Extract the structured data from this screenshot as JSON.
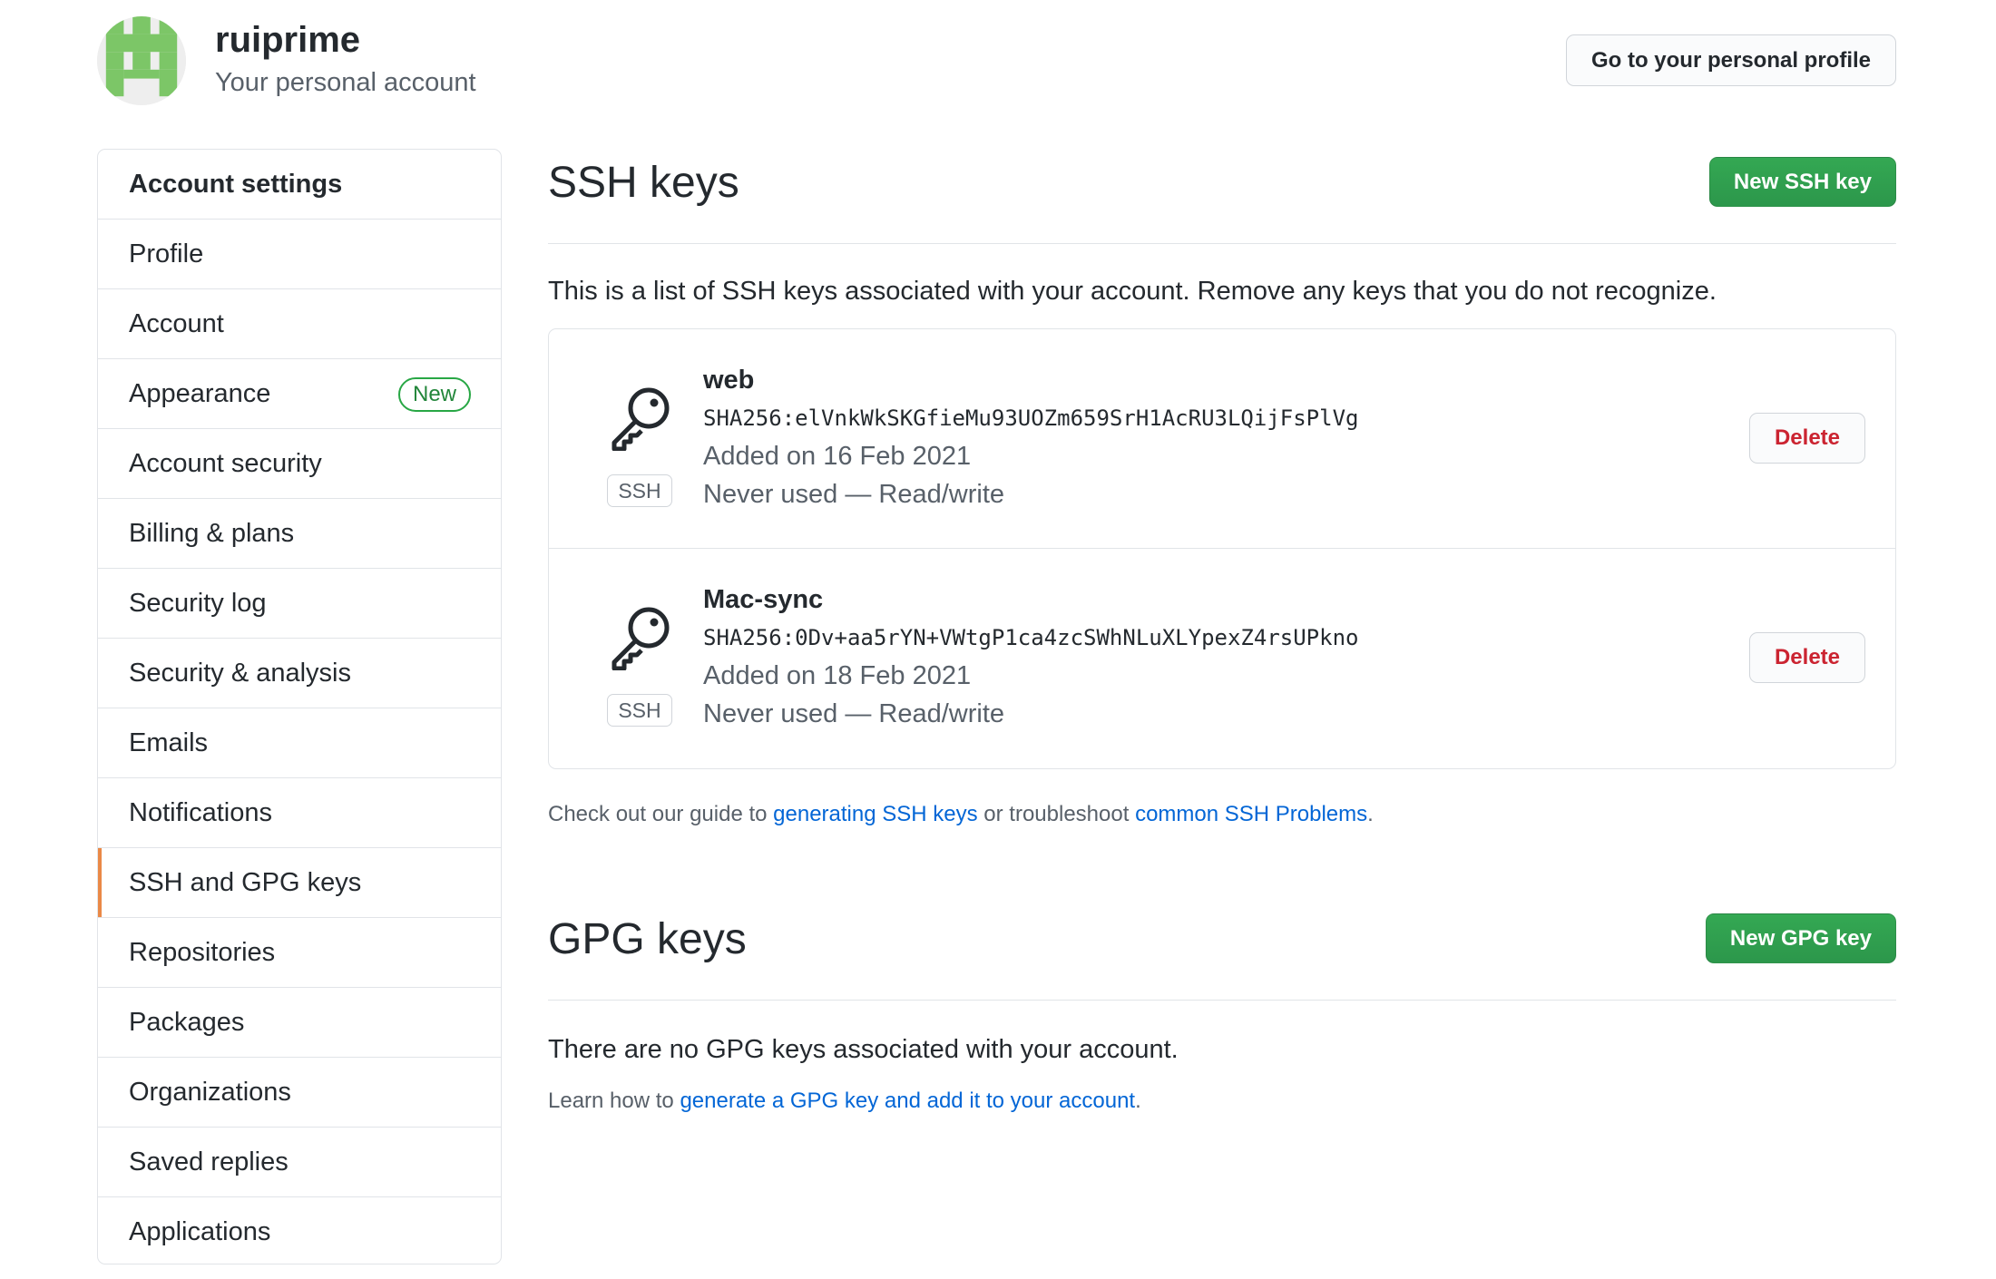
{
  "header": {
    "username": "ruiprime",
    "subtitle": "Your personal account",
    "profile_button": "Go to your personal profile"
  },
  "sidebar": {
    "heading": "Account settings",
    "items": [
      {
        "label": "Profile"
      },
      {
        "label": "Account"
      },
      {
        "label": "Appearance",
        "badge": "New"
      },
      {
        "label": "Account security"
      },
      {
        "label": "Billing & plans"
      },
      {
        "label": "Security log"
      },
      {
        "label": "Security & analysis"
      },
      {
        "label": "Emails"
      },
      {
        "label": "Notifications"
      },
      {
        "label": "SSH and GPG keys",
        "selected": true
      },
      {
        "label": "Repositories"
      },
      {
        "label": "Packages"
      },
      {
        "label": "Organizations"
      },
      {
        "label": "Saved replies"
      },
      {
        "label": "Applications"
      }
    ],
    "selected_accent": "#e36209"
  },
  "ssh": {
    "title": "SSH keys",
    "new_button": "New SSH key",
    "intro": "This is a list of SSH keys associated with your account. Remove any keys that you do not recognize.",
    "keys": [
      {
        "name": "web",
        "badge": "SSH",
        "fingerprint": "SHA256:elVnkWkSKGfieMu93UOZm659SrH1AcRU3LQijFsPlVg",
        "added": "Added on 16 Feb 2021",
        "usage": "Never used — Read/write",
        "delete_label": "Delete",
        "icon": "key-icon"
      },
      {
        "name": "Mac-sync",
        "badge": "SSH",
        "fingerprint": "SHA256:0Dv+aa5rYN+VWtgP1ca4zcSWhNLuXLYpexZ4rsUPkno",
        "added": "Added on 18 Feb 2021",
        "usage": "Never used — Read/write",
        "delete_label": "Delete",
        "icon": "key-icon"
      }
    ],
    "guide_prefix": "Check out our guide to ",
    "guide_link1": "generating SSH keys",
    "guide_middle": " or troubleshoot ",
    "guide_link2": "common SSH Problems",
    "guide_suffix": "."
  },
  "gpg": {
    "title": "GPG keys",
    "new_button": "New GPG key",
    "empty": "There are no GPG keys associated with your account.",
    "learn_prefix": "Learn how to ",
    "learn_link": "generate a GPG key and add it to your account",
    "learn_suffix": "."
  },
  "colors": {
    "primary_green": "#2ea44f",
    "danger_red": "#cb2431",
    "link_blue": "#0366d6",
    "avatar_green": "#7cc667"
  }
}
